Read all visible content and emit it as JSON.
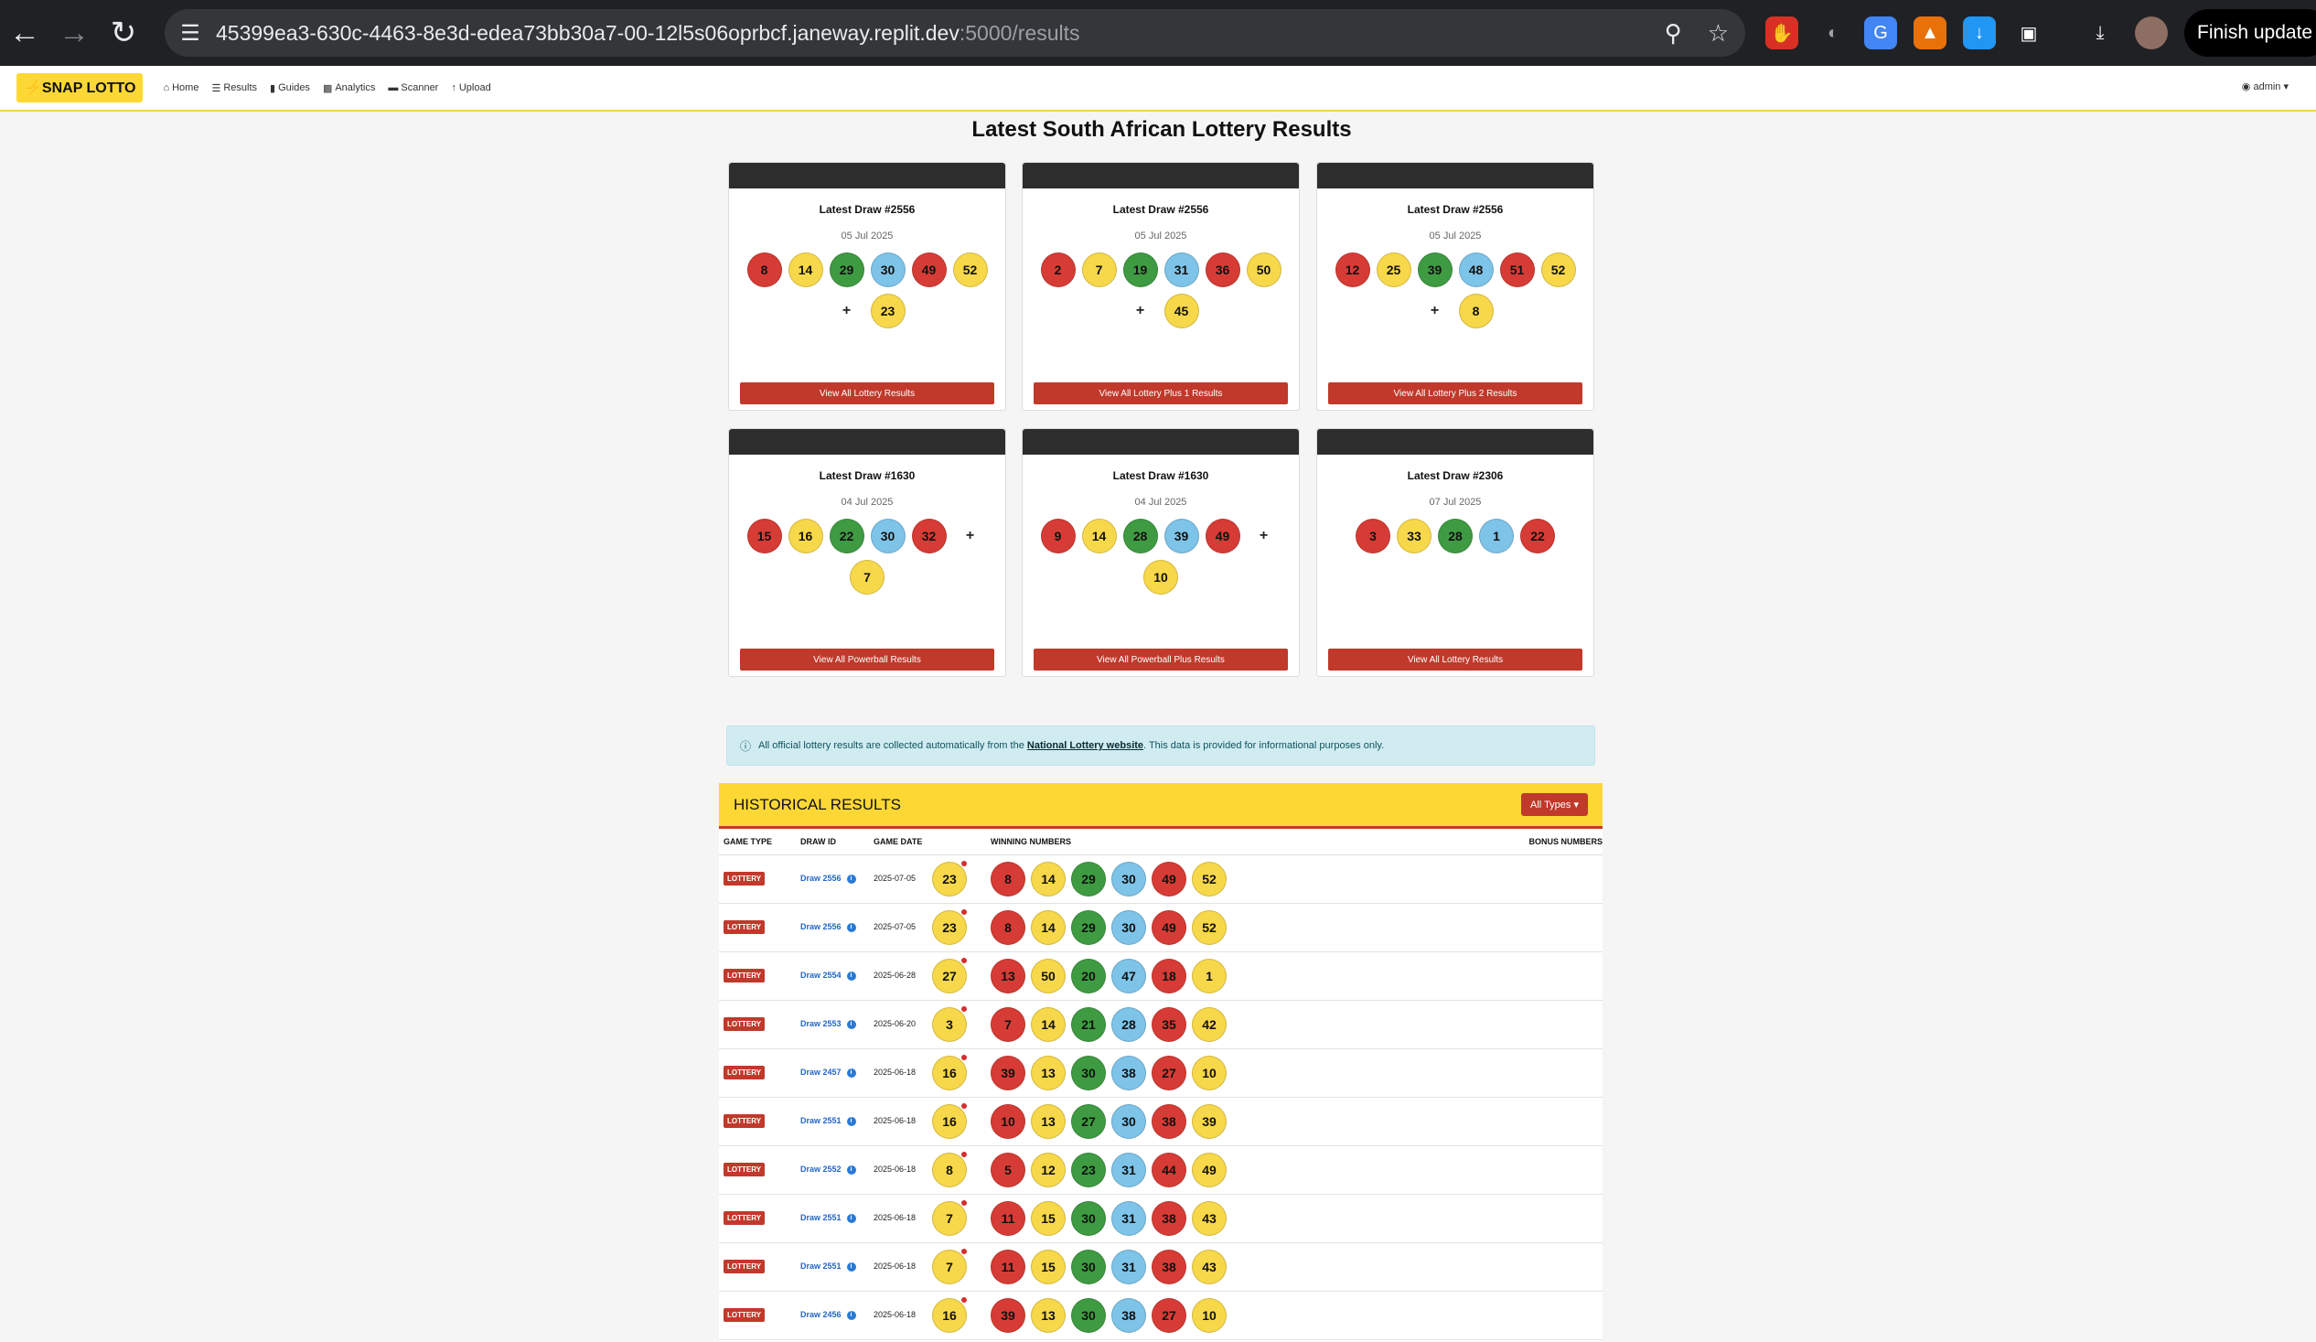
{
  "browser": {
    "url_main": "45399ea3-630c-4463-8e3d-edea73bb30a7-00-12l5s06oprbcf.janeway.replit.dev",
    "url_suffix": ":5000/results",
    "finish_update_label": "Finish update"
  },
  "nav": {
    "brand": "SNAP LOTTO",
    "links": [
      "Home",
      "Results",
      "Guides",
      "Analytics",
      "Scanner",
      "Upload"
    ],
    "admin": "admin"
  },
  "page_title": "Latest South African Lottery Results",
  "cards": [
    {
      "title": "Latest Draw #2556",
      "date": "05 Jul 2025",
      "numbers": [
        "8",
        "14",
        "29",
        "30",
        "49",
        "52"
      ],
      "bonus": "23",
      "button": "View All Lottery Results"
    },
    {
      "title": "Latest Draw #2556",
      "date": "05 Jul 2025",
      "numbers": [
        "2",
        "7",
        "19",
        "31",
        "36",
        "50"
      ],
      "bonus": "45",
      "button": "View All Lottery Plus 1 Results"
    },
    {
      "title": "Latest Draw #2556",
      "date": "05 Jul 2025",
      "numbers": [
        "12",
        "25",
        "39",
        "48",
        "51",
        "52"
      ],
      "bonus": "8",
      "button": "View All Lottery Plus 2 Results"
    },
    {
      "title": "Latest Draw #1630",
      "date": "04 Jul 2025",
      "numbers": [
        "15",
        "16",
        "22",
        "30",
        "32"
      ],
      "bonus": "7",
      "button": "View All Powerball Results"
    },
    {
      "title": "Latest Draw #1630",
      "date": "04 Jul 2025",
      "numbers": [
        "9",
        "14",
        "28",
        "39",
        "49"
      ],
      "bonus": "10",
      "button": "View All Powerball Plus Results"
    },
    {
      "title": "Latest Draw #2306",
      "date": "07 Jul 2025",
      "numbers": [
        "3",
        "33",
        "28",
        "1",
        "22"
      ],
      "bonus": "",
      "button": "View All Lottery Results"
    }
  ],
  "info": {
    "before": "All official lottery results are collected automatically from the ",
    "link": "National Lottery website",
    "after": ". This data is provided for informational purposes only."
  },
  "historical": {
    "title": "HISTORICAL RESULTS",
    "filter_label": "All Types",
    "columns": [
      "GAME TYPE",
      "DRAW ID",
      "GAME DATE",
      "WINNING NUMBERS",
      "BONUS NUMBERS"
    ],
    "rows": [
      {
        "type": "LOTTERY",
        "draw": "Draw 2556",
        "date": "2025-07-05",
        "numbers": [
          "8",
          "14",
          "29",
          "30",
          "49",
          "52"
        ],
        "bonus": "23"
      },
      {
        "type": "LOTTERY",
        "draw": "Draw 2556",
        "date": "2025-07-05",
        "numbers": [
          "8",
          "14",
          "29",
          "30",
          "49",
          "52"
        ],
        "bonus": "23"
      },
      {
        "type": "LOTTERY",
        "draw": "Draw 2554",
        "date": "2025-06-28",
        "numbers": [
          "13",
          "50",
          "20",
          "47",
          "18",
          "1"
        ],
        "bonus": "27"
      },
      {
        "type": "LOTTERY",
        "draw": "Draw 2553",
        "date": "2025-06-20",
        "numbers": [
          "7",
          "14",
          "21",
          "28",
          "35",
          "42"
        ],
        "bonus": "3"
      },
      {
        "type": "LOTTERY",
        "draw": "Draw 2457",
        "date": "2025-06-18",
        "numbers": [
          "39",
          "13",
          "30",
          "38",
          "27",
          "10"
        ],
        "bonus": "16"
      },
      {
        "type": "LOTTERY",
        "draw": "Draw 2551",
        "date": "2025-06-18",
        "numbers": [
          "10",
          "13",
          "27",
          "30",
          "38",
          "39"
        ],
        "bonus": "16"
      },
      {
        "type": "LOTTERY",
        "draw": "Draw 2552",
        "date": "2025-06-18",
        "numbers": [
          "5",
          "12",
          "23",
          "31",
          "44",
          "49"
        ],
        "bonus": "8"
      },
      {
        "type": "LOTTERY",
        "draw": "Draw 2551",
        "date": "2025-06-18",
        "numbers": [
          "11",
          "15",
          "30",
          "31",
          "38",
          "43"
        ],
        "bonus": "7"
      },
      {
        "type": "LOTTERY",
        "draw": "Draw 2551",
        "date": "2025-06-18",
        "numbers": [
          "11",
          "15",
          "30",
          "31",
          "38",
          "43"
        ],
        "bonus": "7"
      },
      {
        "type": "LOTTERY",
        "draw": "Draw 2456",
        "date": "2025-06-18",
        "numbers": [
          "39",
          "13",
          "30",
          "38",
          "27",
          "10"
        ],
        "bonus": "16"
      }
    ]
  },
  "ball_colors": [
    "#d63c35",
    "#f7d84a",
    "#3f9b42",
    "#7ec3e8",
    "#d63c35",
    "#f7d84a"
  ],
  "bonus_color": "#f7d84a"
}
